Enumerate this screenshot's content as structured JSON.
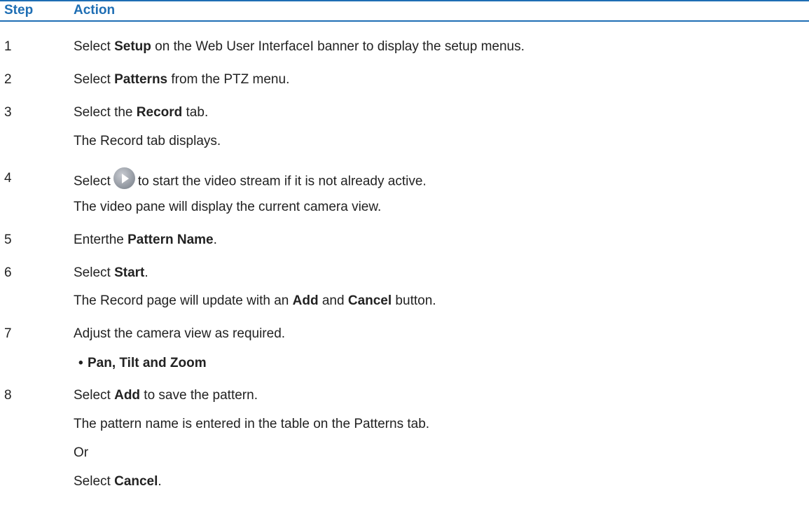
{
  "header": {
    "step": "Step",
    "action": "Action"
  },
  "steps": [
    {
      "num": "1",
      "pre": "Select ",
      "bold": "Setup",
      "post": " on the Web User InterfaceI banner to display the setup menus."
    },
    {
      "num": "2",
      "pre": "Select ",
      "bold": "Patterns",
      "post": " from the PTZ menu."
    },
    {
      "num": "3",
      "pre": "Select the ",
      "bold": "Record",
      "post": " tab."
    },
    {
      "note": "The Record tab displays."
    },
    {
      "num": "4",
      "pre": "Select",
      "icon": "play-icon",
      "post": "to start the video stream if it is not already active."
    },
    {
      "note": "The video pane will display the current camera view."
    },
    {
      "num": "5",
      "pre": "Enterthe ",
      "bold": "Pattern Name",
      "post": "."
    },
    {
      "num": "6",
      "pre": "Select ",
      "bold": "Start",
      "post": "."
    },
    {
      "note_pre": "The Record page will update with an ",
      "note_b1": "Add",
      "note_mid": " and ",
      "note_b2": "Cancel",
      "note_post": " button."
    },
    {
      "num": "7",
      "text": "Adjust the camera view as required."
    },
    {
      "bullet": "•",
      "bullet_text": "Pan, Tilt and Zoom"
    },
    {
      "num": "8",
      "pre": "Select ",
      "bold": "Add",
      "post": " to save the pattern."
    },
    {
      "note": "The pattern name is entered in the table on the Patterns tab."
    },
    {
      "note": "Or"
    },
    {
      "pre": "Select ",
      "bold": "Cancel",
      "post": "."
    }
  ]
}
